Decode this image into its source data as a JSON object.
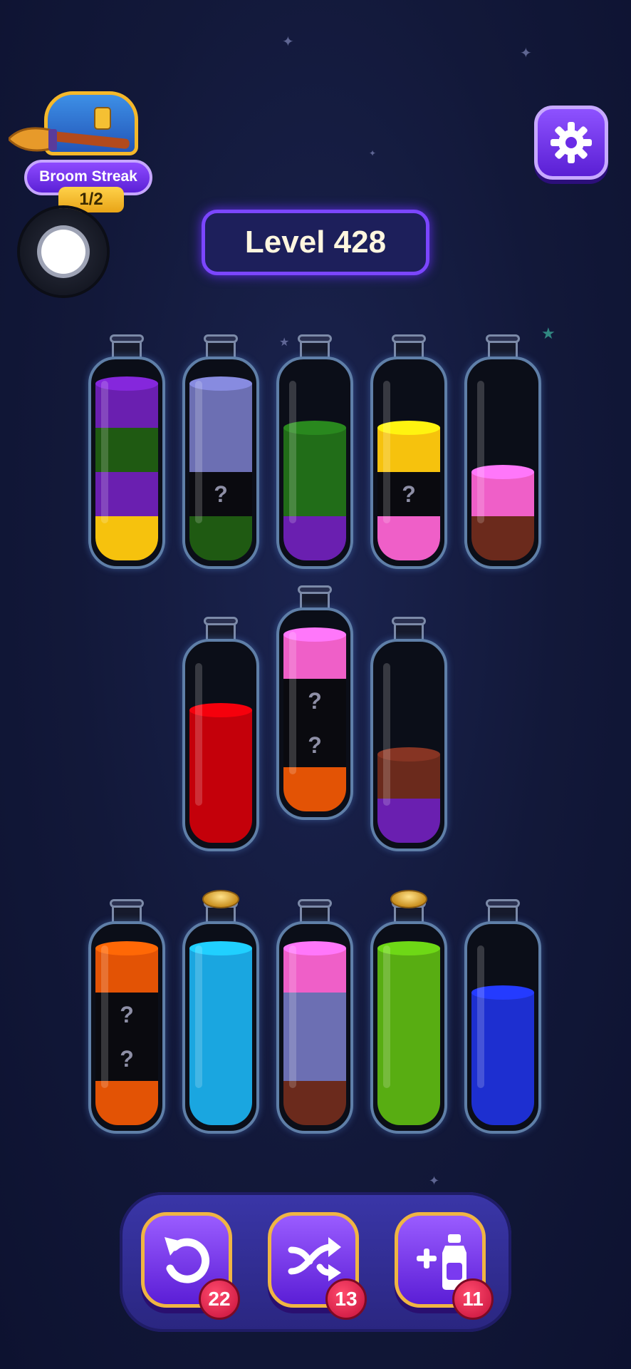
{
  "streak": {
    "title": "Broom Streak",
    "progress": "1/2"
  },
  "level": {
    "label": "Level 428"
  },
  "colors": {
    "purple": "#6a1fb0",
    "dark_green": "#1f5a12",
    "yellow": "#f6c20d",
    "lavender": "#6c6fb3",
    "black": "#0a0a0f",
    "green": "#216d18",
    "pink": "#ef5fc8",
    "brown": "#6b2a1c",
    "red": "#c4000a",
    "orange": "#e35305",
    "cyan": "#1aa6e0",
    "lime": "#58ad12",
    "blue": "#1d2fd0"
  },
  "bottles": [
    {
      "layers": [
        "yellow",
        "purple",
        "dark_green",
        "purple"
      ],
      "corked": false
    },
    {
      "layers": [
        "dark_green",
        "black",
        "lavender",
        "lavender"
      ],
      "corked": false
    },
    {
      "layers": [
        "purple",
        "green",
        "green"
      ],
      "corked": false
    },
    {
      "layers": [
        "pink",
        "black",
        "yellow"
      ],
      "corked": false
    },
    {
      "layers": [
        "brown",
        "pink"
      ],
      "corked": false
    },
    {
      "layers": [
        "red",
        "red",
        "red"
      ],
      "corked": false
    },
    {
      "layers": [
        "orange",
        "black",
        "black",
        "pink"
      ],
      "corked": false
    },
    {
      "layers": [
        "purple",
        "brown"
      ],
      "corked": false
    },
    {
      "layers": [
        "orange",
        "black",
        "black",
        "orange"
      ],
      "corked": false
    },
    {
      "layers": [
        "cyan",
        "cyan",
        "cyan",
        "cyan"
      ],
      "corked": true
    },
    {
      "layers": [
        "brown",
        "lavender",
        "lavender",
        "pink"
      ],
      "corked": false
    },
    {
      "layers": [
        "lime",
        "lime",
        "lime",
        "lime"
      ],
      "corked": true
    },
    {
      "layers": [
        "blue",
        "blue",
        "blue"
      ],
      "corked": false
    }
  ],
  "hidden_mark": "?",
  "tools": {
    "undo": {
      "icon": "undo-icon",
      "count": "22"
    },
    "shuffle": {
      "icon": "shuffle-icon",
      "count": "13"
    },
    "add_bottle": {
      "icon": "add-bottle-icon",
      "count": "11"
    }
  }
}
